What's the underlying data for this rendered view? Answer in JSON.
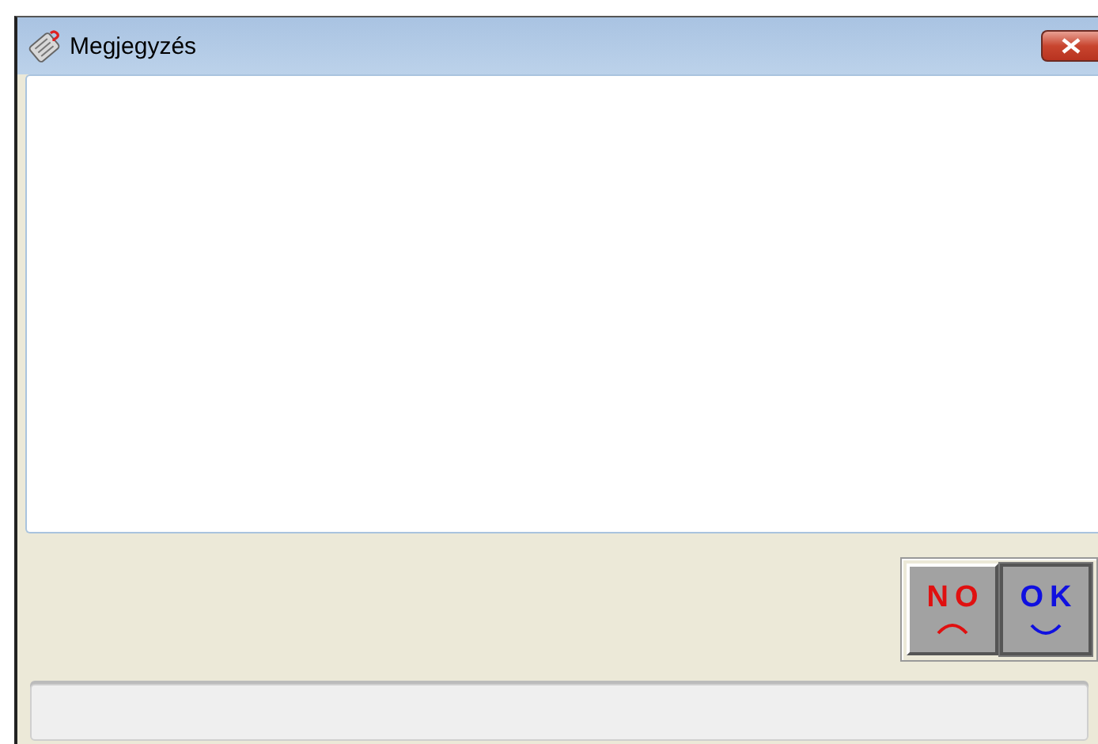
{
  "window": {
    "title": "Megjegyzés"
  },
  "buttons": [
    {
      "kind": "no",
      "label": "NO",
      "default": false
    },
    {
      "kind": "ok",
      "label": "OK",
      "default": true
    }
  ]
}
